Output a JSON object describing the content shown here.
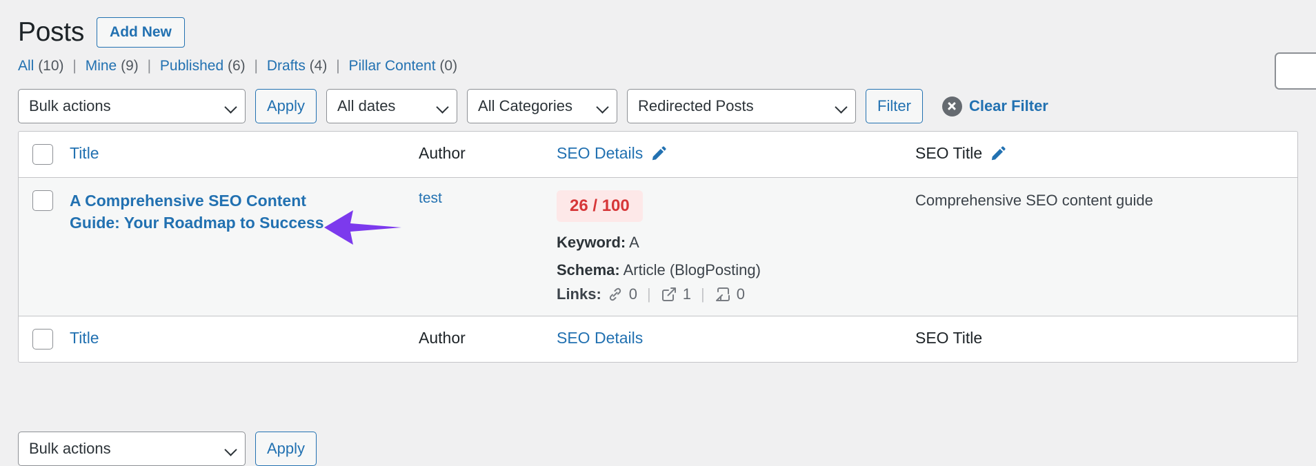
{
  "header": {
    "title": "Posts",
    "add_new_label": "Add New"
  },
  "search": {
    "value": "",
    "placeholder": ""
  },
  "status_links": [
    {
      "label": "All",
      "count": "(10)"
    },
    {
      "label": "Mine",
      "count": "(9)"
    },
    {
      "label": "Published",
      "count": "(6)"
    },
    {
      "label": "Drafts",
      "count": "(4)"
    },
    {
      "label": "Pillar Content",
      "count": "(0)"
    }
  ],
  "separator": "|",
  "toolbar": {
    "bulk_actions_value": "Bulk actions",
    "apply_label": "Apply",
    "dates_value": "All dates",
    "categories_value": "All Categories",
    "redirect_value": "Redirected Posts",
    "filter_label": "Filter",
    "clear_filter_label": "Clear Filter",
    "clear_filter_icon": "circle-x-icon"
  },
  "table": {
    "head": {
      "title": "Title",
      "author": "Author",
      "seo_details": "SEO Details",
      "seo_title": "SEO Title",
      "seo_details_icon": "pencil-icon",
      "seo_title_icon": "pencil-icon"
    },
    "foot": {
      "title": "Title",
      "author": "Author",
      "seo_details": "SEO Details",
      "seo_title": "SEO Title"
    },
    "rows": [
      {
        "post_title": "A Comprehensive SEO Content Guide: Your Roadmap to Success",
        "author": "test",
        "seo_score": "26 / 100",
        "seo_score_color": "#d63638",
        "seo_score_bg": "#fde8e8",
        "keyword_label": "Keyword:",
        "keyword_value": "A",
        "schema_label": "Schema:",
        "schema_value": "Article (BlogPosting)",
        "links_label": "Links:",
        "links": [
          {
            "icon": "internal-link-icon",
            "count": "0"
          },
          {
            "icon": "external-link-icon",
            "count": "1"
          },
          {
            "icon": "inbound-link-icon",
            "count": "0"
          }
        ],
        "seo_title": "Comprehensive SEO content guide"
      }
    ]
  },
  "bottom_toolbar": {
    "bulk_actions_value": "Bulk actions",
    "apply_label": "Apply"
  },
  "annotation": {
    "arrow_color": "#7c3aed",
    "arrow_points_to": "post-title-link"
  },
  "colors": {
    "link_blue": "#2271b1",
    "text_dark": "#1d2327",
    "text_muted": "#50575e",
    "page_bg": "#f0f0f1",
    "row_bg": "#f6f7f7",
    "border": "#c3c4c7"
  }
}
